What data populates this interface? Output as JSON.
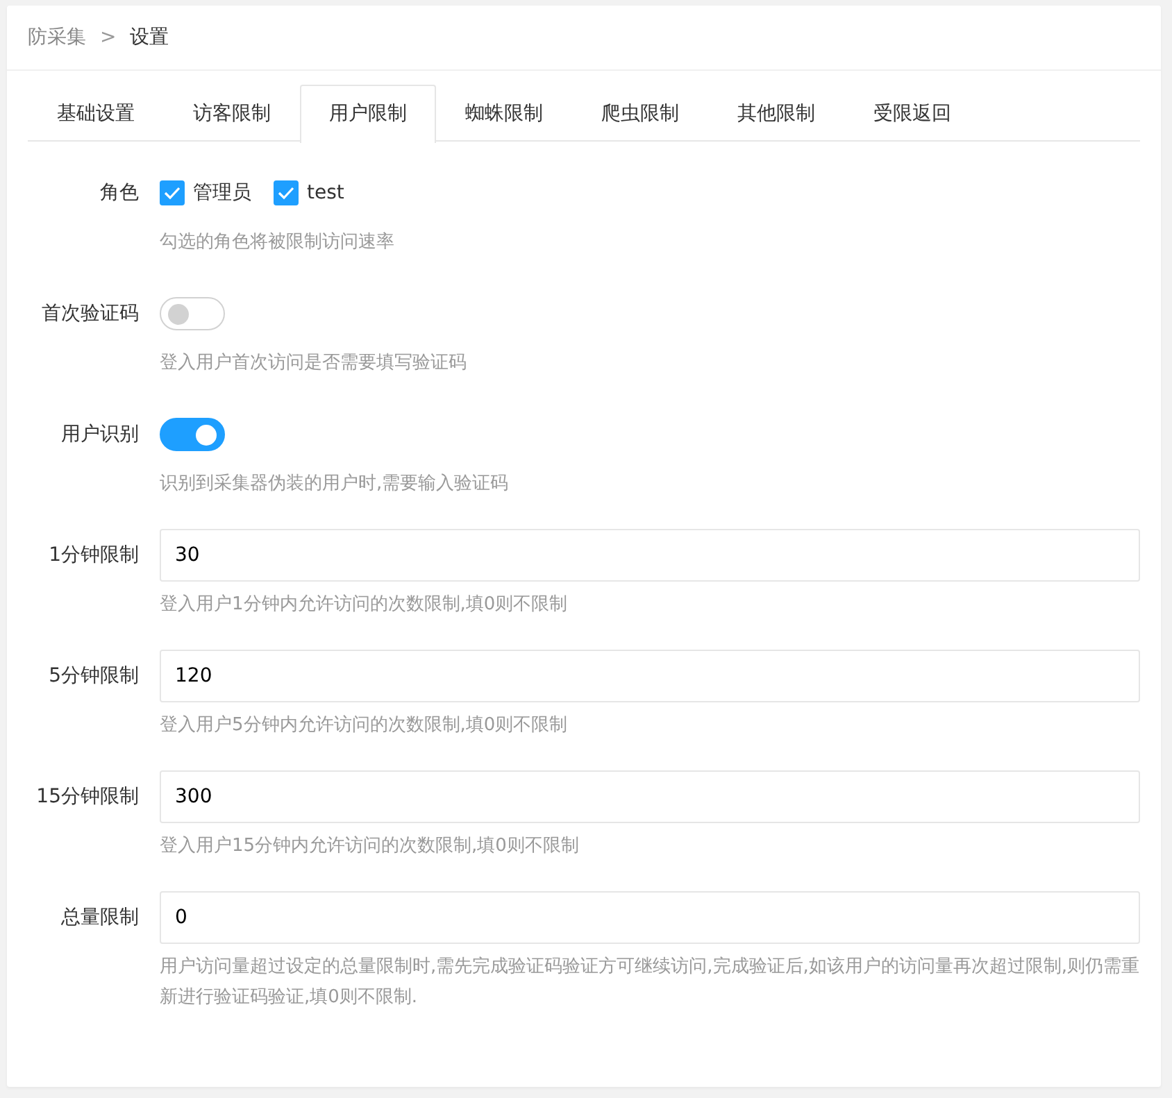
{
  "breadcrumb": [
    "防采集",
    "设置"
  ],
  "breadcrumb_separator": ">",
  "tabs": [
    {
      "label": "基础设置",
      "selected": false
    },
    {
      "label": "访客限制",
      "selected": false
    },
    {
      "label": "用户限制",
      "selected": true
    },
    {
      "label": "蜘蛛限制",
      "selected": false
    },
    {
      "label": "爬虫限制",
      "selected": false
    },
    {
      "label": "其他限制",
      "selected": false
    },
    {
      "label": "受限返回",
      "selected": false
    }
  ],
  "form": [
    {
      "kind": "checkboxes",
      "label": "角色",
      "options": [
        {
          "label": "管理员",
          "checked": true
        },
        {
          "label": "test",
          "checked": true
        }
      ],
      "hint": "勾选的角色将被限制访问速率"
    },
    {
      "kind": "switch",
      "label": "首次验证码",
      "on": false,
      "hint": "登入用户首次访问是否需要填写验证码"
    },
    {
      "kind": "switch",
      "label": "用户识别",
      "on": true,
      "hint": "识别到采集器伪装的用户时,需要输入验证码"
    },
    {
      "kind": "input",
      "label": "1分钟限制",
      "value": "30",
      "hint": "登入用户1分钟内允许访问的次数限制,填0则不限制"
    },
    {
      "kind": "input",
      "label": "5分钟限制",
      "value": "120",
      "hint": "登入用户5分钟内允许访问的次数限制,填0则不限制"
    },
    {
      "kind": "input",
      "label": "15分钟限制",
      "value": "300",
      "hint": "登入用户15分钟内允许访问的次数限制,填0则不限制"
    },
    {
      "kind": "input",
      "label": "总量限制",
      "value": "0",
      "hint": "用户访问量超过设定的总量限制时,需先完成验证码验证方可继续访问,完成验证后,如该用户的访问量再次超过限制,则仍需重新进行验证码验证,填0则不限制."
    }
  ]
}
